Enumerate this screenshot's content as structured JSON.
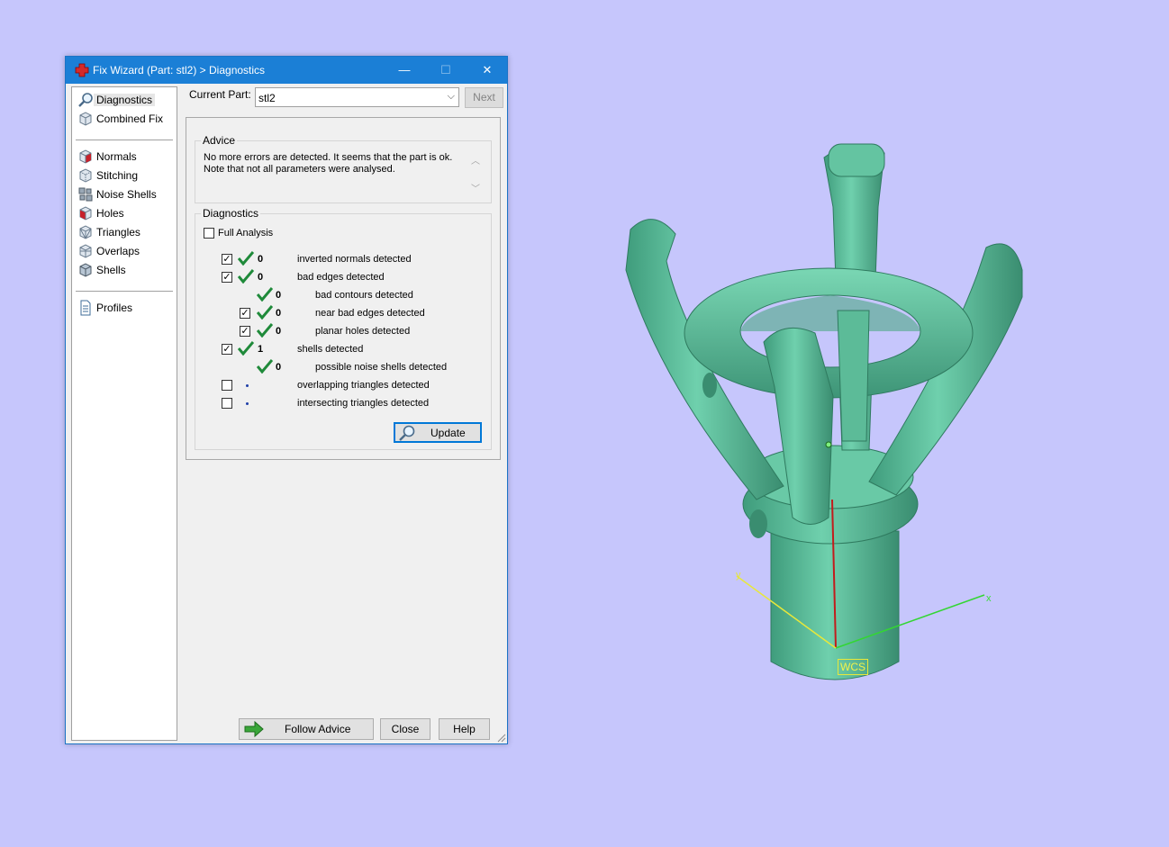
{
  "window": {
    "title": "Fix Wizard (Part: stl2) > Diagnostics",
    "minimize": "—",
    "maximize": "☐",
    "close": "✕"
  },
  "nav": {
    "items": [
      {
        "label": "Diagnostics",
        "icon": "magnifier-icon"
      },
      {
        "label": "Combined Fix",
        "icon": "cube-icon"
      },
      {
        "label": "Normals",
        "icon": "normals-cube-icon"
      },
      {
        "label": "Stitching",
        "icon": "stitching-cube-icon"
      },
      {
        "label": "Noise Shells",
        "icon": "noise-shells-icon"
      },
      {
        "label": "Holes",
        "icon": "holes-cube-icon"
      },
      {
        "label": "Triangles",
        "icon": "triangles-cube-icon"
      },
      {
        "label": "Overlaps",
        "icon": "overlaps-cube-icon"
      },
      {
        "label": "Shells",
        "icon": "shells-cube-icon"
      },
      {
        "label": "Profiles",
        "icon": "document-icon"
      }
    ],
    "selected": "Diagnostics"
  },
  "current_part": {
    "label": "Current Part:",
    "value": "stl2",
    "next_label": "Next"
  },
  "advice": {
    "legend": "Advice",
    "line1": "No more errors are detected. It seems that the part is ok.",
    "line2": "Note that not all parameters were analysed."
  },
  "diagnostics": {
    "legend": "Diagnostics",
    "full_analysis": "Full Analysis",
    "rows": [
      {
        "count": "0",
        "label": "inverted normals detected",
        "checked": true,
        "status": "ok"
      },
      {
        "count": "0",
        "label": "bad edges detected",
        "checked": true,
        "status": "ok"
      },
      {
        "count": "0",
        "label": "bad contours detected",
        "checked": null,
        "status": "ok"
      },
      {
        "count": "0",
        "label": "near bad edges detected",
        "checked": true,
        "status": "ok"
      },
      {
        "count": "0",
        "label": "planar holes detected",
        "checked": true,
        "status": "ok"
      },
      {
        "count": "1",
        "label": "shells detected",
        "checked": true,
        "status": "ok"
      },
      {
        "count": "0",
        "label": "possible noise shells detected",
        "checked": null,
        "status": "ok"
      },
      {
        "count": "",
        "label": "overlapping triangles detected",
        "checked": false,
        "status": "not-analysed"
      },
      {
        "count": "",
        "label": "intersecting triangles detected",
        "checked": false,
        "status": "not-analysed"
      }
    ],
    "update_label": "Update"
  },
  "footer": {
    "follow_advice": "Follow Advice",
    "close": "Close",
    "help": "Help"
  },
  "viewport": {
    "wcs_label": "WCS",
    "x_axis": "x",
    "y_axis": "y",
    "model_color": "#5fbf9e",
    "background": "#c6c6fc"
  }
}
